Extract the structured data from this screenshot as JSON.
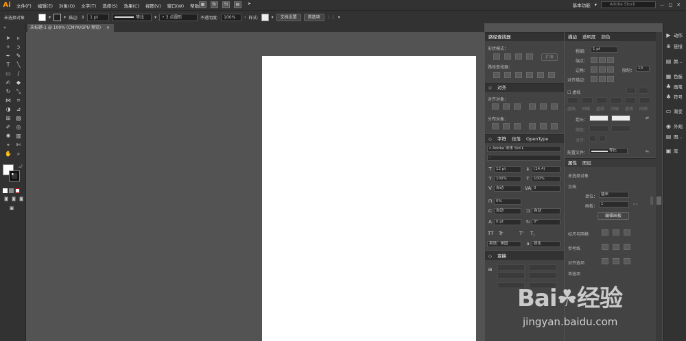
{
  "app": {
    "logo": "Ai",
    "workspace": "基本功能",
    "search_placeholder": "Adobe Stock",
    "br": "Br",
    "st": "St"
  },
  "menu": [
    "文件(F)",
    "编辑(E)",
    "对象(O)",
    "文字(T)",
    "选择(S)",
    "效果(C)",
    "视图(V)",
    "窗口(W)",
    "帮助(H)"
  ],
  "control_bar": {
    "selection": "未选择对象",
    "stroke_label": "描边:",
    "stroke_value": "1 pt",
    "profile_label": "等比",
    "brush_label": "3 点圆形",
    "opacity_label": "不透明度:",
    "opacity_value": "100%",
    "style_label": "样式:",
    "doc_setup": "文档设置",
    "preferences": "首选项"
  },
  "document_tab": {
    "title": "未标题-1 @ 100% (CMYK/GPU 预览)",
    "close": "×"
  },
  "pathfinder": {
    "title": "路径查找器",
    "shape_modes": "形状模式：",
    "expand": "扩展",
    "pathfinders": "路径查找器："
  },
  "align": {
    "title": "对齐",
    "align_objects": "对齐对象：",
    "distribute_objects": "分布对象："
  },
  "character": {
    "tabs": [
      "字符",
      "段落",
      "OpenType"
    ],
    "font": "Adobe 宋体 Std L",
    "style": "-",
    "size": "12 pt",
    "leading": "(14.4)",
    "hscale": "100%",
    "vscale": "100%",
    "kerning": "自动",
    "tracking": "0",
    "tsume": "0%",
    "aki_left": "自动",
    "aki_right": "自动",
    "baseline": "0 pt",
    "rotation": "0°",
    "language": "英语：美国",
    "aa": "锐化",
    "caps": [
      "TT",
      "Tr",
      "T'",
      "T,"
    ]
  },
  "transform": {
    "title": "变换"
  },
  "stroke_panel": {
    "tabs": [
      "描边",
      "透明度",
      "颜色"
    ],
    "weight_label": "粗细：",
    "weight_value": "1 pt",
    "cap_label": "端点：",
    "corner_label": "边角：",
    "limit_label": "限制：",
    "limit_value": "10",
    "align_label": "对齐描边：",
    "dashed_label": "虚线",
    "dash_labels": [
      "虚线",
      "间隙",
      "虚线",
      "间隙",
      "虚线",
      "间隙"
    ],
    "arrow_label": "箭头：",
    "scale_label": "缩放：",
    "aligns_label": "对齐：",
    "profile_label": "配置文件：",
    "profile_value": "等比"
  },
  "properties": {
    "tabs": [
      "属性",
      "图层"
    ],
    "no_selection": "未选择对象",
    "document": "文档",
    "units_label": "单位：",
    "units_value": "厘米",
    "artboard_label": "画板：",
    "artboard_value": "1",
    "edit_artboards": "编辑画板",
    "rulers_grids": "标尺与网格",
    "guides": "参考线",
    "snap_options": "对齐选项",
    "preferences": "首选项"
  },
  "right_strip": [
    {
      "icon": "▶",
      "label": "动作"
    },
    {
      "icon": "⊕",
      "label": "链接"
    },
    {
      "icon": "▤",
      "label": "颜..."
    },
    {
      "icon": "▦",
      "label": "色板"
    },
    {
      "icon": "♣",
      "label": "画笔"
    },
    {
      "icon": "♣",
      "label": "符号"
    },
    {
      "icon": "▭",
      "label": "渐变"
    },
    {
      "icon": "◉",
      "label": "外观"
    },
    {
      "icon": "▤",
      "label": "图..."
    },
    {
      "icon": "▣",
      "label": "库"
    }
  ],
  "watermark": {
    "brand": "Bai",
    "brand2": "经验",
    "url": "jingyan.baidu.com"
  }
}
